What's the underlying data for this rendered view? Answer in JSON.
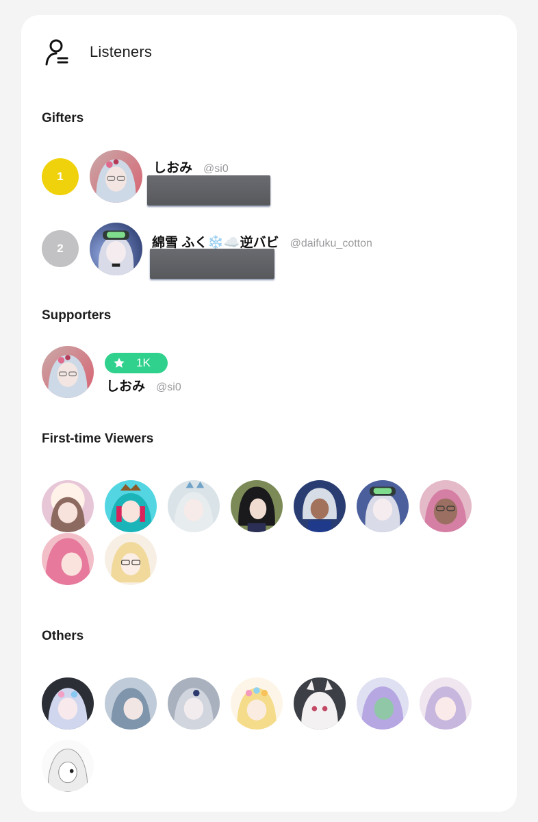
{
  "header": {
    "title": "Listeners",
    "icon": "listener-user-icon"
  },
  "gifters": {
    "title": "Gifters",
    "items": [
      {
        "rank": "1",
        "rank_color": "#efd20b",
        "name": "しおみ",
        "handle": "@si0"
      },
      {
        "rank": "2",
        "rank_color": "#c2c2c4",
        "name": "綿雪 ふく❄️☁️逆バビ",
        "handle": "@daifuku_cotton"
      }
    ]
  },
  "supporters": {
    "title": "Supporters",
    "items": [
      {
        "badge": "1K",
        "badge_color": "#2fd18c",
        "badge_icon": "star-icon",
        "name": "しおみ",
        "handle": "@si0"
      }
    ]
  },
  "first_time_viewers": {
    "title": "First-time Viewers",
    "count": 9
  },
  "others": {
    "title": "Others",
    "count": 8
  }
}
